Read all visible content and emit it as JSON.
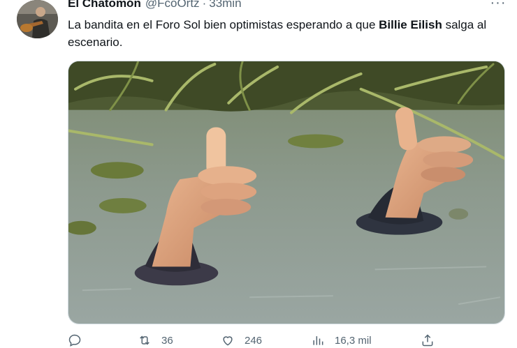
{
  "tweet": {
    "author_name": "El Chatomón",
    "author_handle": "@FcoOrtz",
    "separator": "·",
    "time": "33min",
    "more_label": "···",
    "text_before": "La bandita en el Foro Sol bien optimistas esperando a que ",
    "text_bold": "Billie Eilish",
    "text_after": " salga al escenario.",
    "replies": "",
    "retweets": "36",
    "likes": "246",
    "views": "16,3 mil"
  },
  "icons": {
    "reply": "reply-bubble-icon",
    "retweet": "retweet-icon",
    "like": "heart-icon",
    "views": "views-chart-icon",
    "share": "share-upload-icon",
    "more": "more-dots-icon"
  },
  "colors": {
    "text": "#0f1419",
    "muted": "#536471",
    "border": "#cfd9de"
  }
}
